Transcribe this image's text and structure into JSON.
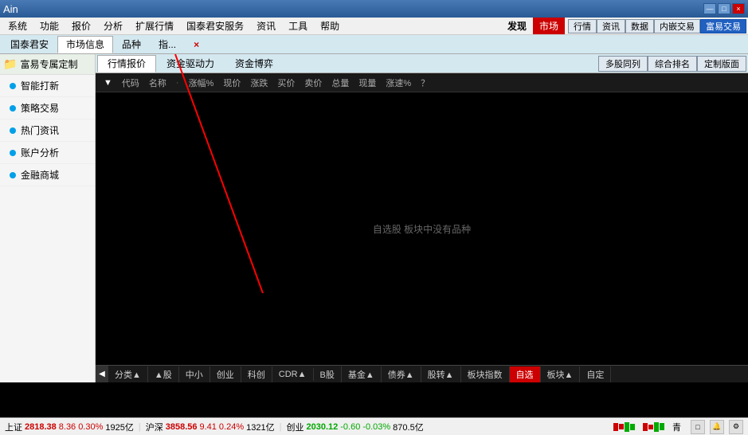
{
  "titlebar": {
    "title": "Ain",
    "winbtns": [
      "—",
      "□",
      "×"
    ]
  },
  "menubar": {
    "items": [
      "系统",
      "功能",
      "报价",
      "分析",
      "扩展行情",
      "国泰君安服务",
      "资讯",
      "工具",
      "帮助",
      "发现",
      "市场"
    ],
    "rightbtns": [
      "行情",
      "资讯",
      "数据",
      "内嵌交易",
      "富易交易"
    ]
  },
  "secondbar": {
    "tabs": [
      "国泰君安",
      "市场信息",
      "品种",
      "指...",
      "×"
    ]
  },
  "subtabs": {
    "tabs": [
      "行情报价",
      "资金驱动力",
      "资金博弈"
    ],
    "rightbtns": [
      "多股同列",
      "综合排名",
      "定制版面"
    ]
  },
  "colheaders": {
    "cols": [
      "▼",
      "代码",
      "名称",
      "·",
      "涨幅%",
      "现价",
      "涨跌",
      "买价",
      "卖价",
      "总量",
      "现量",
      "涨速%",
      "？"
    ]
  },
  "emptymsg": "自选股 板块中没有品种",
  "bottomtabs": {
    "arrow": "◀",
    "tabs": [
      "分类▲",
      "▲股",
      "中小",
      "创业",
      "科创",
      "CDR▲",
      "B股",
      "基金▲",
      "债券▲",
      "股转▲",
      "板块指数",
      "自选",
      "板块▲",
      "自定"
    ],
    "active": "自选"
  },
  "statusbar": {
    "items": [
      {
        "label": "上证",
        "value": "2818.38",
        "change": "8.36",
        "pct": "0.30%",
        "vol": "1925亿",
        "positive": true
      },
      {
        "label": "沪深",
        "value": "3858.56",
        "change": "9.41",
        "pct": "0.24%",
        "vol": "1321亿",
        "positive": true
      },
      {
        "label": "创业",
        "value": "2030.12",
        "change": "-0.60",
        "pct": "-0.03%",
        "vol": "870.5亿",
        "positive": false
      }
    ]
  },
  "sidebar": {
    "tabs": [
      "国泰君安",
      "市场信息",
      "品种",
      "指数"
    ],
    "folder": "富易专属定制",
    "items": [
      "智能打新",
      "策略交易",
      "热门资讯",
      "账户分析",
      "金融商城"
    ]
  },
  "icons": {
    "folder": "📁",
    "dot_blue": "●"
  }
}
